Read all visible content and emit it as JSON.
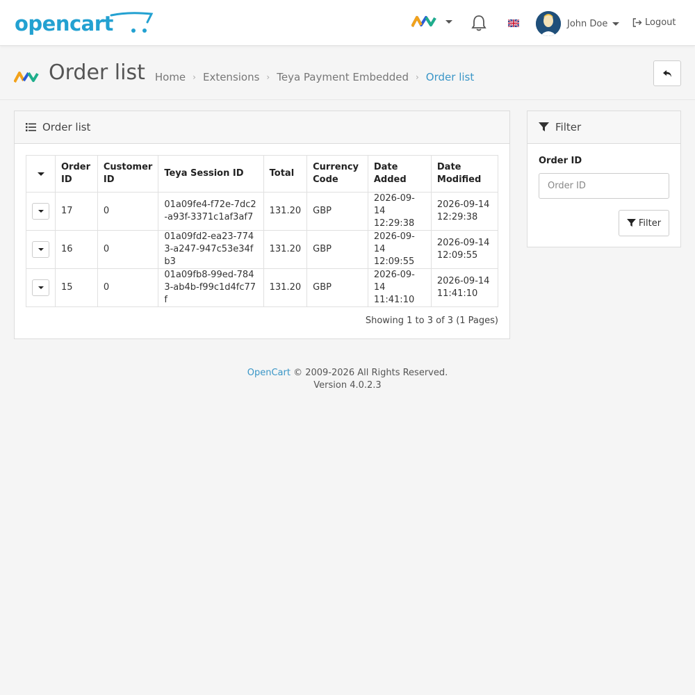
{
  "header": {
    "logo_text": "opencart",
    "user_name": "John Doe",
    "logout_label": "Logout"
  },
  "page": {
    "title": "Order list",
    "breadcrumbs": [
      "Home",
      "Extensions",
      "Teya Payment Embedded",
      "Order list"
    ]
  },
  "order_card": {
    "title": "Order list",
    "columns": [
      "Order ID",
      "Customer ID",
      "Teya Session ID",
      "Total",
      "Currency Code",
      "Date Added",
      "Date Modified"
    ],
    "rows": [
      {
        "order_id": "17",
        "customer_id": "0",
        "session_id": "01a09fe4-f72e-7dc2-a93f-3371c1af3af7",
        "total": "131.20",
        "currency": "GBP",
        "date_added": "2026-09-14 12:29:38",
        "date_modified": "2026-09-14 12:29:38"
      },
      {
        "order_id": "16",
        "customer_id": "0",
        "session_id": "01a09fd2-ea23-7743-a247-947c53e34fb3",
        "total": "131.20",
        "currency": "GBP",
        "date_added": "2026-09-14 12:09:55",
        "date_modified": "2026-09-14 12:09:55"
      },
      {
        "order_id": "15",
        "customer_id": "0",
        "session_id": "01a09fb8-99ed-7843-ab4b-f99c1d4fc77f",
        "total": "131.20",
        "currency": "GBP",
        "date_added": "2026-09-14 11:41:10",
        "date_modified": "2026-09-14 11:41:10"
      }
    ],
    "showing": "Showing 1 to 3 of 3 (1 Pages)"
  },
  "filter": {
    "title": "Filter",
    "order_id_label": "Order ID",
    "order_id_placeholder": "Order ID",
    "order_id_value": "",
    "button_label": "Filter"
  },
  "footer": {
    "brand": "OpenCart",
    "copyright": "© 2009-2026 All Rights Reserved.",
    "version": "Version 4.0.2.3"
  },
  "colors": {
    "brand": "#23a1d1",
    "link": "#3a96c7"
  }
}
